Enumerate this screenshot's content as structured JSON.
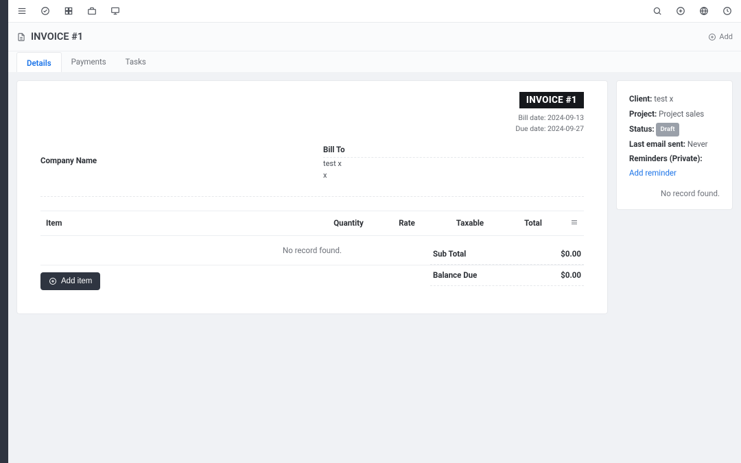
{
  "page": {
    "title": "INVOICE #1",
    "add_label": "Add"
  },
  "tabs": [
    {
      "label": "Details",
      "active": true
    },
    {
      "label": "Payments",
      "active": false
    },
    {
      "label": "Tasks",
      "active": false
    }
  ],
  "invoice": {
    "badge": "INVOICE #1",
    "bill_date_label": "Bill date:",
    "bill_date_value": "2024-09-13",
    "due_date_label": "Due date:",
    "due_date_value": "2024-09-27",
    "company_name_label": "Company Name",
    "bill_to_label": "Bill To",
    "bill_to_name": "test x",
    "bill_to_extra": "x"
  },
  "items_table": {
    "columns": {
      "item": "Item",
      "quantity": "Quantity",
      "rate": "Rate",
      "taxable": "Taxable",
      "total": "Total"
    },
    "empty_text": "No record found.",
    "rows": []
  },
  "add_item_label": "Add item",
  "totals": {
    "subtotal_label": "Sub Total",
    "subtotal_value": "$0.00",
    "balance_due_label": "Balance Due",
    "balance_due_value": "$0.00"
  },
  "side": {
    "client_label": "Client:",
    "client_value": "test x",
    "project_label": "Project:",
    "project_value": "Project sales",
    "status_label": "Status:",
    "status_value": "Draft",
    "last_email_label": "Last email sent:",
    "last_email_value": "Never",
    "reminders_label": "Reminders (Private):",
    "add_reminder": "Add reminder",
    "empty_text": "No record found."
  }
}
